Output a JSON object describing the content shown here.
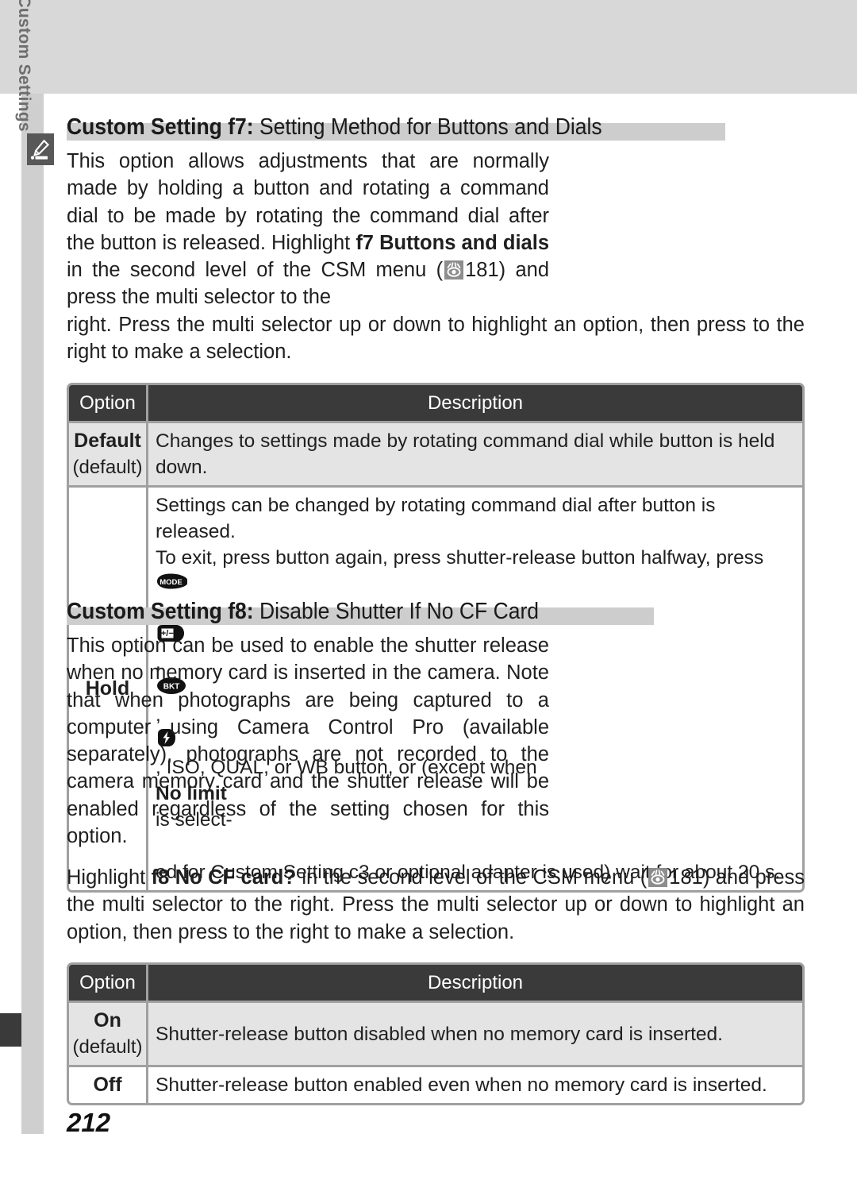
{
  "page": {
    "number": "212",
    "sidebar_label": "Menu Guide—Custom Settings",
    "tab_icon": "pencil-writing-icon"
  },
  "sections": [
    {
      "id": "f7",
      "heading_bold": "Custom Setting f7:",
      "heading_rest": " Setting Method for Buttons and Dials",
      "paragraph_a_1": "This option allows adjustments that are normally made by holding a button and rotating a command dial to be made by rotating the command dial after the button is released.  Highlight ",
      "paragraph_a_bold": "f7 Buttons and dials",
      "paragraph_a_2": " in the second level of the CSM menu (",
      "page_ref": "181",
      "paragraph_a_3": ") and press the multi selector to the",
      "paragraph_b": "right.  Press the multi selector up or down to highlight an option, then press to the right to make a selection."
    },
    {
      "id": "f8",
      "heading_bold": "Custom Setting f8:",
      "heading_rest": " Disable Shutter If No CF Card",
      "paragraph_a": "This option can be used to enable the shutter release when no memory card is inserted in the camera.  Note that when photographs are being captured to a computer using Camera Control Pro (available separately), photographs are not recorded to the camera memory card and the shutter release will be enabled regardless of the setting chosen for this option.",
      "paragraph_b_1": "Highlight ",
      "paragraph_b_bold": "f8 No CF card?",
      "paragraph_b_2": " in the second level of the CSM menu (",
      "page_ref": "181",
      "paragraph_b_3": ") and press the multi selector to the right.  Press the multi selector up or down to highlight an option, then press to the right to make a selection."
    }
  ],
  "table_f7": {
    "headers": [
      "Option",
      "Description"
    ],
    "rows": [
      {
        "option": "Default",
        "option_sub": "(default)",
        "description": "Changes to settings made by rotating command dial while button is held down."
      },
      {
        "option": "Hold",
        "option_sub": "",
        "desc_line1": "Settings can be changed by rotating command dial after button is released.",
        "desc_line2_a": "To exit, press button again, press shutter-release button halfway, press ",
        "desc_icons": [
          "MODE",
          "exposure-compensation",
          "BKT",
          "flash"
        ],
        "desc_line3_a": ", ISO, QUAL, or WB button, or (except when ",
        "desc_line3_bold": "No limit",
        "desc_line3_b": " is select-",
        "desc_line4": "ed for Custom Setting c3 or optional adapter is used) wait for about 20 s."
      }
    ]
  },
  "table_f8": {
    "headers": [
      "Option",
      "Description"
    ],
    "rows": [
      {
        "option": "On",
        "option_sub": "(default)",
        "description": "Shutter-release button disabled when no memory card is inserted."
      },
      {
        "option": "Off",
        "option_sub": "",
        "description": "Shutter-release button enabled even when no memory card is inserted."
      }
    ]
  },
  "colors": {
    "top_band": "#d8d8d8",
    "sidebar": "#cfcfcf",
    "tab_dark": "#585858",
    "heading_highlight": "#cdcdcd",
    "table_header": "#3a3a3a",
    "table_border": "#a0a0a0",
    "row_shade": "#e4e4e4"
  }
}
